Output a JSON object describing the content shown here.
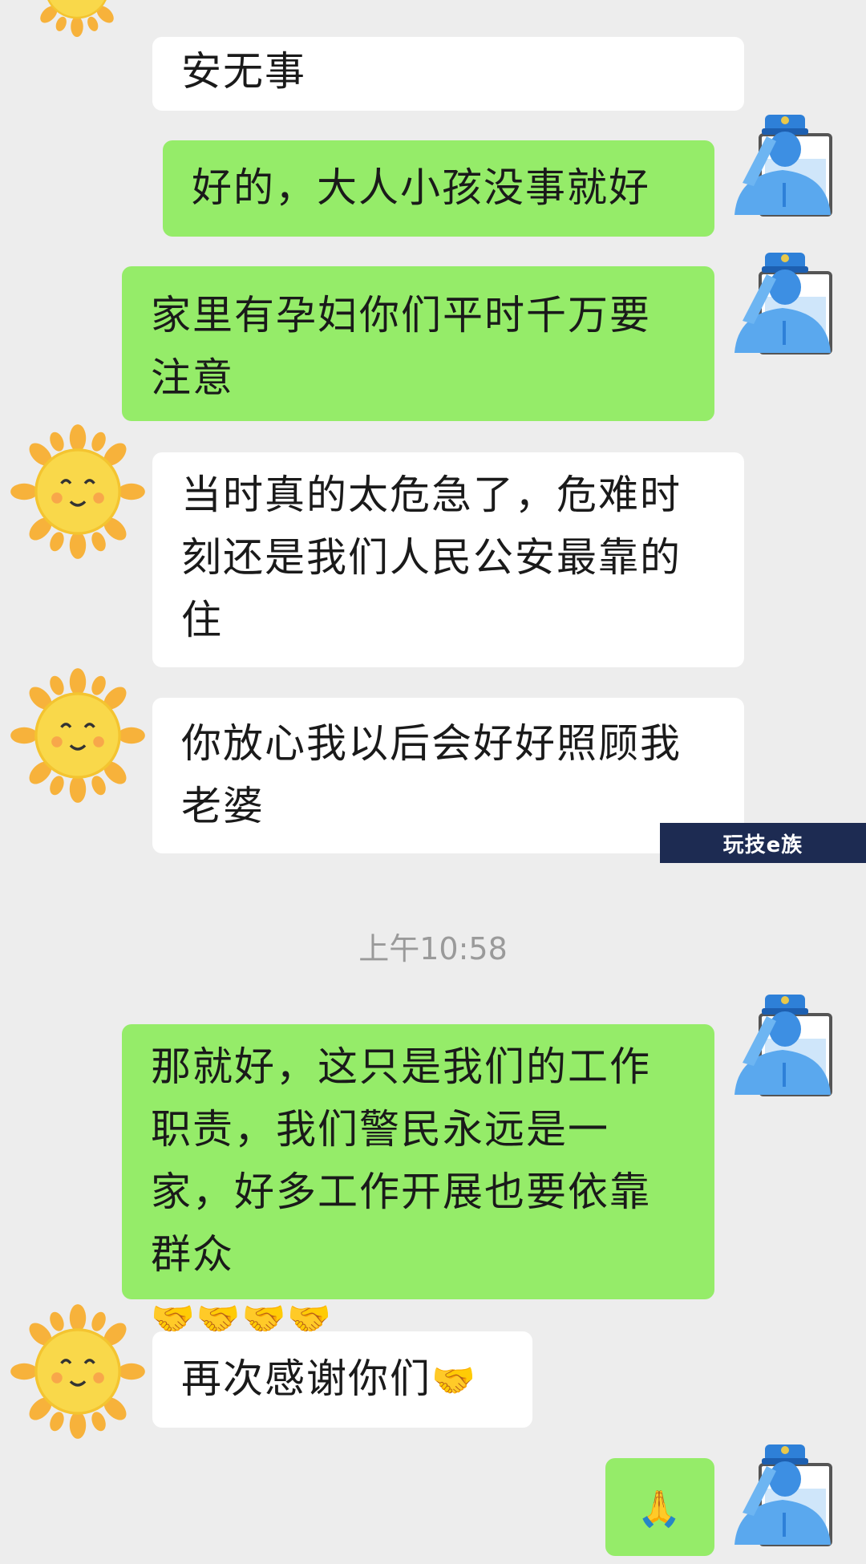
{
  "chat": {
    "messages": [
      {
        "id": 1,
        "sender": "other",
        "text": "安无事"
      },
      {
        "id": 2,
        "sender": "self",
        "text": "好的，大人小孩没事就好"
      },
      {
        "id": 3,
        "sender": "self",
        "text": "家里有孕妇你们平时千万要注意"
      },
      {
        "id": 4,
        "sender": "other",
        "text": "当时真的太危急了，危难时刻还是我们人民公安最靠的住"
      },
      {
        "id": 5,
        "sender": "other",
        "text": "你放心我以后会好好照顾我老婆"
      },
      {
        "id": 6,
        "sender": "self",
        "text": "那就好，这只是我们的工作职责，我们警民永远是一家，好多工作开展也要依靠群众",
        "emoji": "🤝🤝🤝🤝"
      },
      {
        "id": 7,
        "sender": "other",
        "text": "再次感谢你们",
        "emoji": "🤝"
      },
      {
        "id": 8,
        "sender": "self",
        "emoji": "🙏"
      }
    ],
    "timestamp": "上午10:58"
  },
  "watermark": {
    "text": "玩技e族"
  },
  "colors": {
    "background": "#ededed",
    "incoming_bubble": "#ffffff",
    "outgoing_bubble": "#95ec69",
    "timestamp": "#9a9a9a",
    "watermark_bg": "#1d2b52"
  },
  "icons": {
    "other_avatar": "smiling-sun-icon",
    "self_avatar": "saluting-police-officer-icon"
  }
}
